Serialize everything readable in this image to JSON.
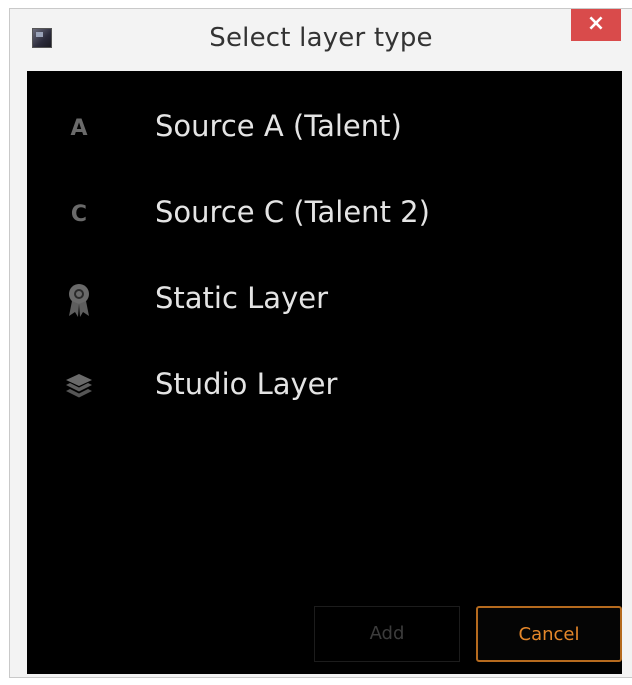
{
  "window": {
    "title": "Select layer type",
    "close_label": "×",
    "app_icon": "app-icon"
  },
  "layers": [
    {
      "label": "Source A (Talent)",
      "icon": "letter-a-icon",
      "icon_glyph": "A"
    },
    {
      "label": "Source C (Talent 2)",
      "icon": "letter-c-icon",
      "icon_glyph": "C"
    },
    {
      "label": "Static Layer",
      "icon": "ribbon-badge-icon"
    },
    {
      "label": "Studio Layer",
      "icon": "layers-stack-icon"
    }
  ],
  "buttons": {
    "add_label": "Add",
    "cancel_label": "Cancel"
  },
  "colors": {
    "background": "#000000",
    "accent": "#e5872a",
    "close": "#d94b4b"
  }
}
